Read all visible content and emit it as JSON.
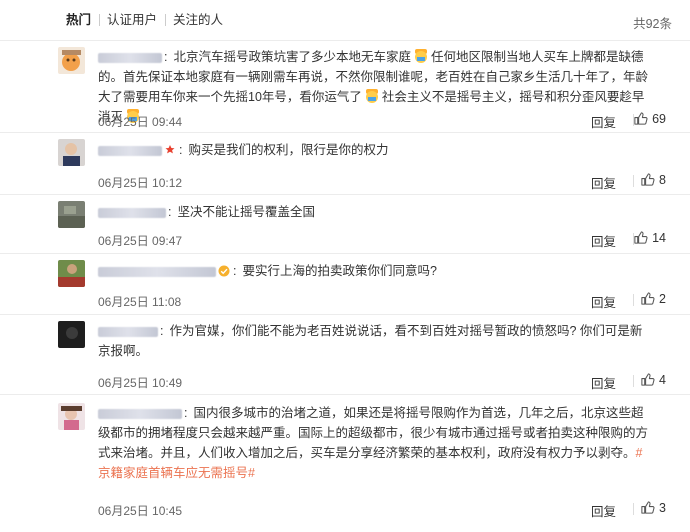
{
  "tabs": [
    {
      "label": "热门",
      "active": true
    },
    {
      "label": "认证用户",
      "active": false
    },
    {
      "label": "关注的人",
      "active": false
    }
  ],
  "total_label": "共92条",
  "reply_label": "回复",
  "topic_color": "#eb7350",
  "comments": [
    {
      "text_parts": [
        "北京汽车摇号政策坑害了多少本地无车家庭",
        "任何地区限制当地人买车上牌都是缺德的。首先保证本地家庭有一辆刚需车再说，不然你限制谁呢，老百姓在自己家乡生活几十年了，年龄大了需要用车你来一个先摇10年号，看你运气了",
        "社会主义不是摇号主义，摇号和积分歪风要趁早消灭"
      ],
      "time": "06月25日 09:44",
      "likes": "69",
      "badge": "none"
    },
    {
      "text": "购买是我们的权利，限行是你的权力",
      "time": "06月25日 10:12",
      "likes": "8",
      "badge": "red"
    },
    {
      "text": "坚决不能让摇号覆盖全国",
      "time": "06月25日 09:47",
      "likes": "14",
      "badge": "none"
    },
    {
      "text": "要实行上海的拍卖政策你们同意吗?",
      "time": "06月25日 11:08",
      "likes": "2",
      "badge": "yellow"
    },
    {
      "text": "作为官媒，你们能不能为老百姓说说话，看不到百姓对摇号暂政的愤怒吗? 你们可是新京报啊。",
      "time": "06月25日 10:49",
      "likes": "4",
      "badge": "none"
    },
    {
      "text": "国内很多城市的治堵之道，如果还是将摇号限购作为首选，几年之后，北京这些超级都市的拥堵程度只会越来越严重。国际上的超级都市，很少有城市通过摇号或者拍卖这种限购的方式来治堵。并且，人们收入增加之后，买车是分享经济繁荣的基本权利，政府没有权力予以剥夺。",
      "topic": "#京籍家庭首辆车应无需摇号#",
      "time": "06月25日 10:45",
      "likes": "3",
      "badge": "none"
    }
  ]
}
